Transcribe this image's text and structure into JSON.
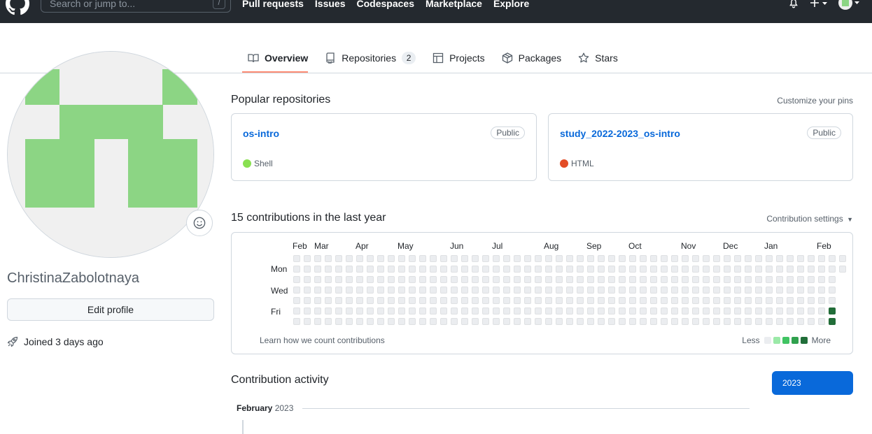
{
  "header": {
    "search_placeholder": "Search or jump to...",
    "search_shortcut": "/",
    "nav": [
      "Pull requests",
      "Issues",
      "Codespaces",
      "Marketplace",
      "Explore"
    ],
    "icons": [
      "mark-github-icon",
      "bell-icon",
      "plus-icon",
      "avatar-icon"
    ]
  },
  "tabs": [
    {
      "label": "Overview",
      "icon": "book-icon",
      "active": true
    },
    {
      "label": "Repositories",
      "icon": "repo-icon",
      "count": "2"
    },
    {
      "label": "Projects",
      "icon": "table-icon"
    },
    {
      "label": "Packages",
      "icon": "package-icon"
    },
    {
      "label": "Stars",
      "icon": "star-icon"
    }
  ],
  "profile": {
    "username": "ChristinaZabolotnaya",
    "edit_label": "Edit profile",
    "joined": "Joined 3 days ago",
    "avatar_color": "#8cd584"
  },
  "pinned": {
    "title": "Popular repositories",
    "customize": "Customize your pins",
    "repos": [
      {
        "name": "os-intro",
        "visibility": "Public",
        "language": "Shell",
        "lang_color": "#89e051"
      },
      {
        "name": "study_2022-2023_os-intro",
        "visibility": "Public",
        "language": "HTML",
        "lang_color": "#e34c26"
      }
    ]
  },
  "contributions": {
    "title": "15 contributions in the last year",
    "settings": "Contribution settings",
    "months": [
      "Feb",
      "Mar",
      "Apr",
      "May",
      "Jun",
      "Jul",
      "Aug",
      "Sep",
      "Oct",
      "Nov",
      "Dec",
      "Jan",
      "Feb"
    ],
    "days": [
      "Mon",
      "Wed",
      "Fri"
    ],
    "learn": "Learn how we count contributions",
    "less": "Less",
    "more": "More",
    "levels": [
      "#ebedf0",
      "#9be9a8",
      "#40c463",
      "#30a14e",
      "#216e39"
    ],
    "active_cells": [
      {
        "week": 51,
        "day": 5,
        "level": 4
      },
      {
        "week": 51,
        "day": 6,
        "level": 4
      }
    ]
  },
  "activity": {
    "title": "Contribution activity",
    "year": "2023",
    "month": "February",
    "month_year": "2023"
  }
}
